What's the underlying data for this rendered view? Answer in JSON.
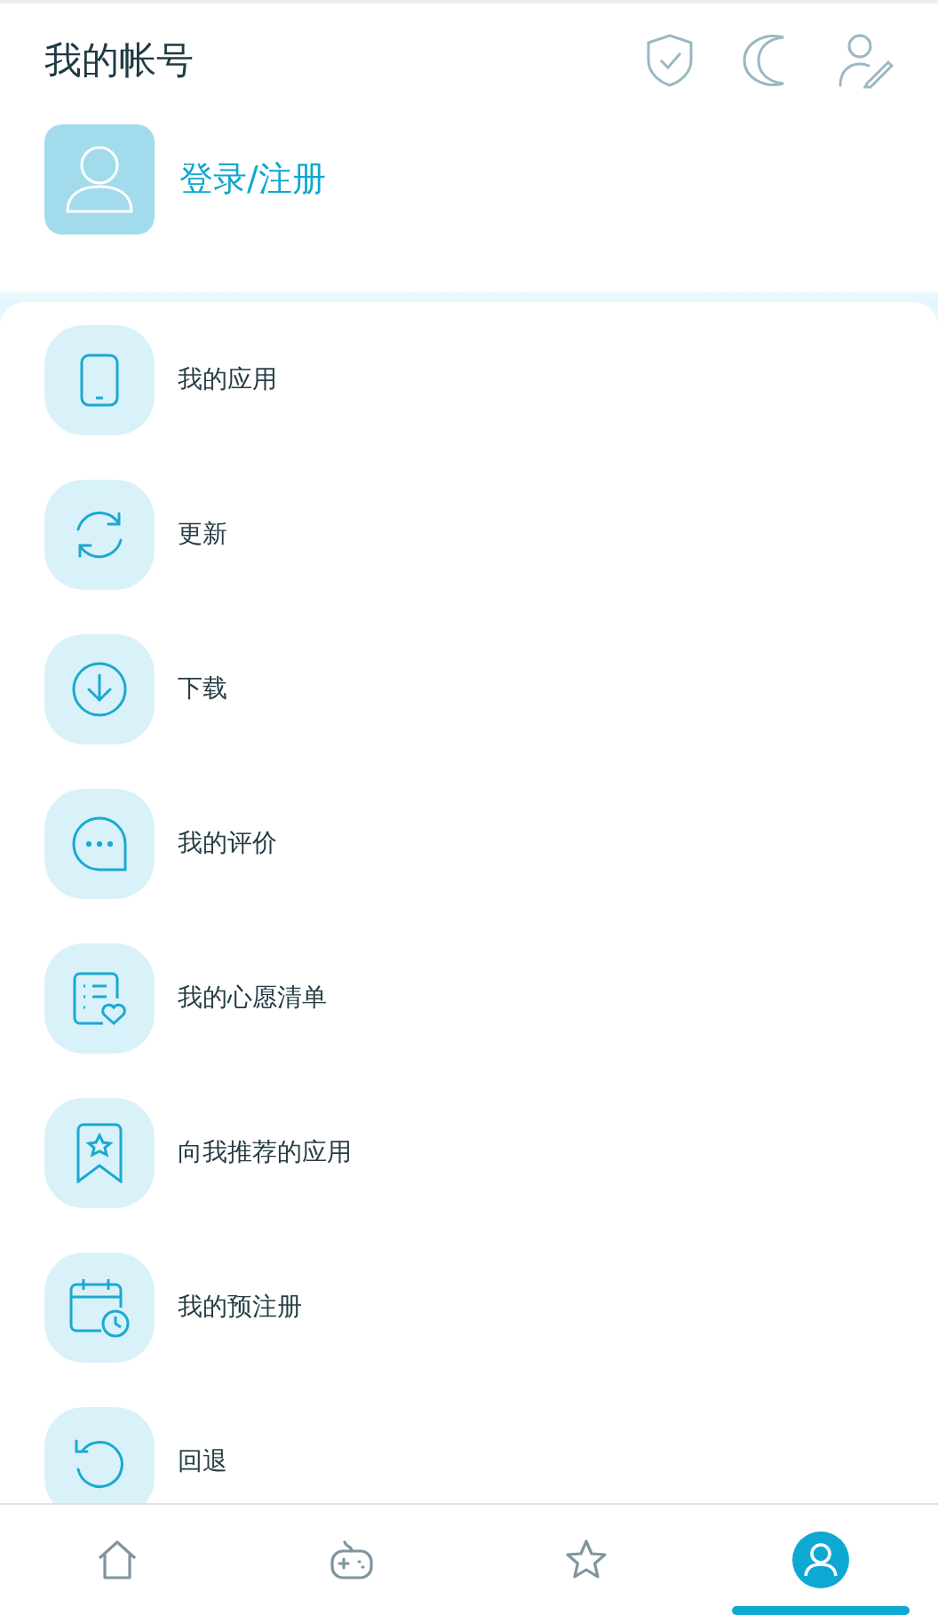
{
  "header": {
    "title": "我的帐号",
    "login": "登录/注册"
  },
  "menu": [
    {
      "label": "我的应用"
    },
    {
      "label": "更新"
    },
    {
      "label": "下载"
    },
    {
      "label": "我的评价"
    },
    {
      "label": "我的心愿清单"
    },
    {
      "label": "向我推荐的应用"
    },
    {
      "label": "我的预注册"
    },
    {
      "label": "回退"
    }
  ],
  "bottom_nav": [
    {
      "selected": false
    },
    {
      "selected": false
    },
    {
      "selected": false
    },
    {
      "selected": true
    }
  ]
}
